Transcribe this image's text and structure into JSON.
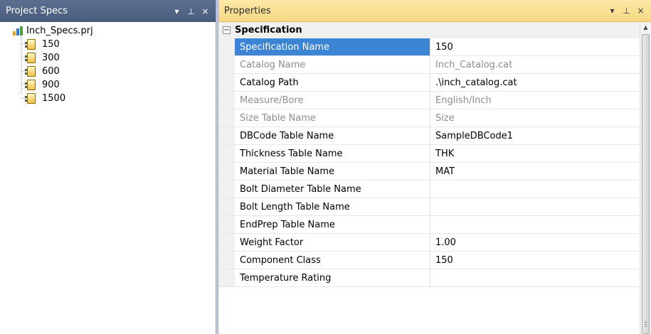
{
  "left_panel": {
    "title": "Project Specs",
    "root": "Inch_Specs.prj",
    "items": [
      "150",
      "300",
      "600",
      "900",
      "1500"
    ]
  },
  "right_panel": {
    "title": "Properties",
    "category": "Specification",
    "rows": [
      {
        "name": "Specification Name",
        "value": "150"
      },
      {
        "name": "Catalog Name",
        "value": "Inch_Catalog.cat"
      },
      {
        "name": "Catalog Path",
        "value": ".\\inch_catalog.cat"
      },
      {
        "name": "Measure/Bore",
        "value": "English/Inch"
      },
      {
        "name": "Size Table Name",
        "value": "Size"
      },
      {
        "name": "DBCode Table Name",
        "value": "SampleDBCode1"
      },
      {
        "name": "Thickness Table Name",
        "value": "THK"
      },
      {
        "name": "Material Table Name",
        "value": "MAT"
      },
      {
        "name": "Bolt Diameter Table Name",
        "value": ""
      },
      {
        "name": "Bolt Length Table Name",
        "value": ""
      },
      {
        "name": "EndPrep Table Name",
        "value": ""
      },
      {
        "name": "Weight Factor",
        "value": "1.00"
      },
      {
        "name": "Component Class",
        "value": "150"
      },
      {
        "name": "Temperature Rating",
        "value": ""
      }
    ]
  },
  "title_buttons": {
    "dropdown": "▾",
    "pin": "⊥",
    "close": "×"
  },
  "colors": {
    "selection": "#3b85d4",
    "active_title": "#f6d883",
    "inactive_title": "#4a5c7c"
  }
}
